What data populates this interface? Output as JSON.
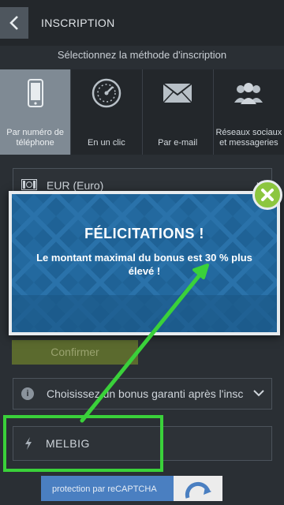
{
  "header": {
    "title": "INSCRIPTION"
  },
  "subtitle": "Sélectionnez la méthode d'inscription",
  "methods": [
    {
      "label": "Par numéro de téléphone",
      "icon": "phone-icon",
      "active": true
    },
    {
      "label": "En un clic",
      "icon": "speedometer-icon",
      "active": false
    },
    {
      "label": "Par e-mail",
      "icon": "envelope-icon",
      "active": false
    },
    {
      "label": "Réseaux sociaux et messageries",
      "icon": "people-icon",
      "active": false
    }
  ],
  "currency": {
    "value": "EUR (Euro)",
    "icon": "banknote-icon"
  },
  "dialog": {
    "title": "FÉLICITATIONS !",
    "message": "Le montant maximal du bonus est 30 % plus élevé !"
  },
  "confirm": {
    "label": "Confirmer"
  },
  "bonus": {
    "placeholder": "Choisissez un bonus garanti après l'inscription",
    "icon": "info-icon"
  },
  "promo": {
    "value": "MELBIG",
    "icon": "lightning-icon"
  },
  "recaptcha": {
    "label": "protection par reCAPTCHA"
  },
  "colors": {
    "accent_green": "#3ad13a",
    "close_green": "#8cc63f",
    "dialog_blue": "#1e5f92"
  }
}
